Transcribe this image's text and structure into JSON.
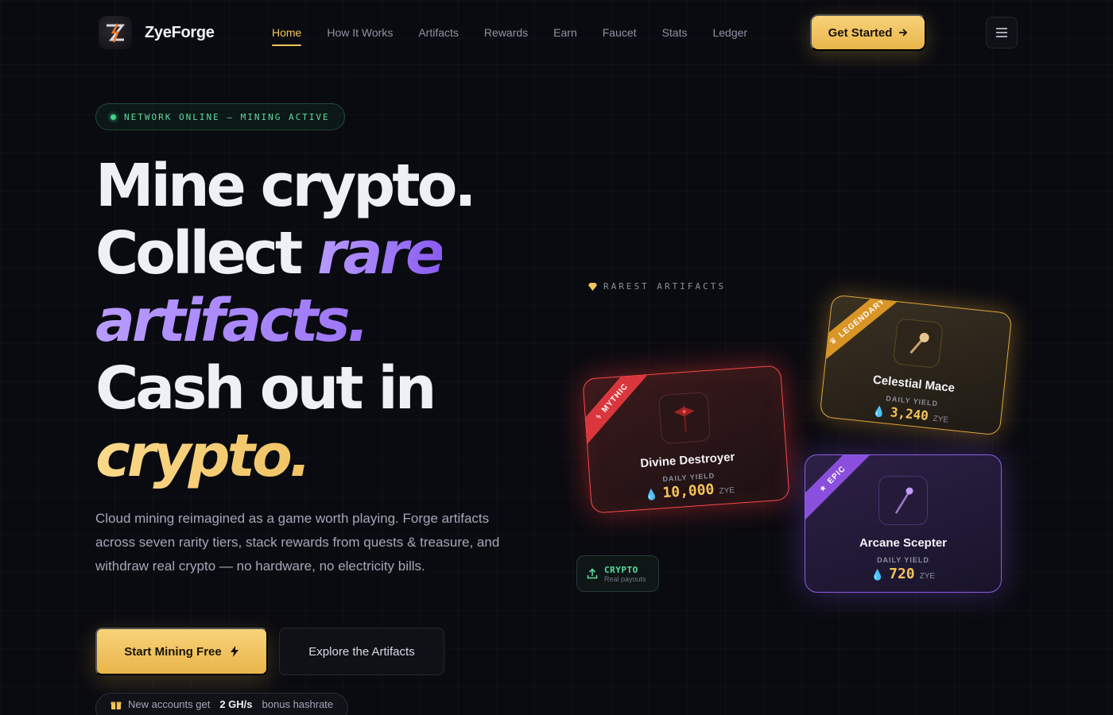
{
  "brand": {
    "name": "ZyeForge"
  },
  "nav": {
    "items": [
      {
        "label": "Home",
        "active": true
      },
      {
        "label": "How It Works",
        "active": false
      },
      {
        "label": "Artifacts",
        "active": false
      },
      {
        "label": "Rewards",
        "active": false
      },
      {
        "label": "Earn",
        "active": false
      },
      {
        "label": "Faucet",
        "active": false
      },
      {
        "label": "Stats",
        "active": false
      },
      {
        "label": "Ledger",
        "active": false
      }
    ],
    "cta_label": "Get Started",
    "menu_icon": "hamburger-menu-icon"
  },
  "hero": {
    "status": "NETWORK ONLINE — MINING ACTIVE",
    "headline": {
      "line1": "Mine crypto.",
      "line2_plain": "Collect",
      "line2_accent": "rare",
      "line3_accent": "artifacts.",
      "line4": "Cash out in",
      "line5_accent": "crypto."
    },
    "subcopy": "Cloud mining reimagined as a game worth playing. Forge artifacts across seven rarity tiers, stack rewards from quests & treasure, and withdraw real crypto — no hardware, no electricity bills.",
    "primary_button": "Start Mining Free",
    "secondary_button": "Explore the Artifacts",
    "bonus": {
      "prefix": "New accounts get",
      "amount": "2 GH/s",
      "suffix": "bonus hashrate"
    }
  },
  "artifacts": {
    "section_label": "RAREST ARTIFACTS",
    "yield_label": "DAILY YIELD",
    "unit": "ZYE",
    "cards": [
      {
        "rarity": "MYTHIC",
        "name": "Divine Destroyer",
        "daily_yield": "10,000",
        "color": "#ff4a4a"
      },
      {
        "rarity": "LEGENDARY",
        "name": "Celestial Mace",
        "daily_yield": "3,240",
        "color": "#e2a93c"
      },
      {
        "rarity": "EPIC",
        "name": "Arcane Scepter",
        "daily_yield": "720",
        "color": "#8b5fe6"
      }
    ]
  },
  "crypto_badge": {
    "title": "CRYPTO",
    "subtitle": "Real payouts"
  },
  "colors": {
    "accent_gold": "#f4c45a",
    "accent_purple": "#9b73f5",
    "online_green": "#3fd48a",
    "background": "#0a0b10"
  }
}
